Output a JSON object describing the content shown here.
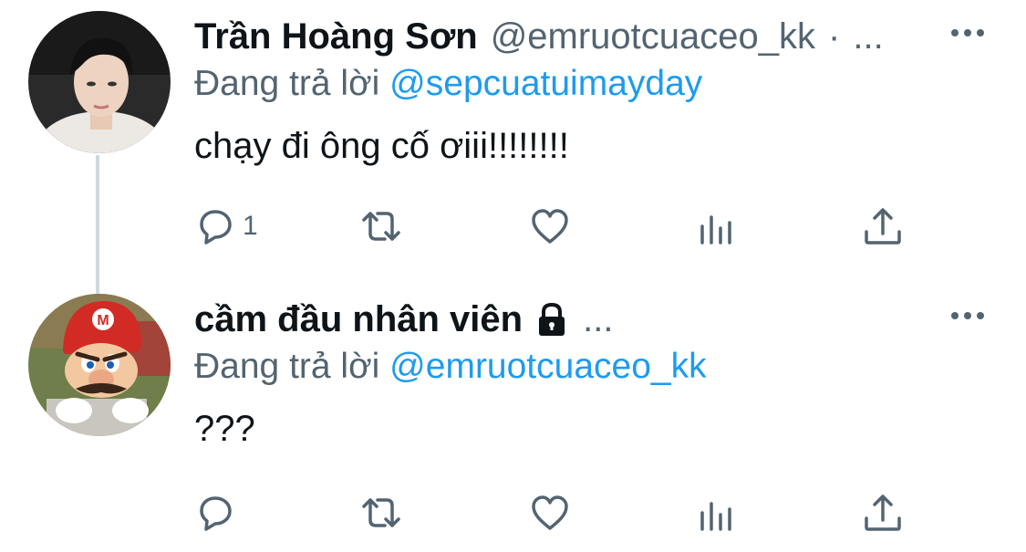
{
  "thread": [
    {
      "author": {
        "name": "Trần Hoàng Sơn",
        "handle": "@emruotcuaceo_kk",
        "separator": "·",
        "truncation": "..."
      },
      "reply_label": "Đang trả lời",
      "reply_to": "@sepcuatuimayday",
      "text": "chạy đi ông cố ơiii!!!!!!!!",
      "reply_count": "1",
      "avatar": "avatar-young-man-photo",
      "icons": {
        "more": "more-icon",
        "reply": "reply-icon",
        "retweet": "retweet-icon",
        "like": "like-icon",
        "views": "views-icon",
        "share": "share-icon"
      }
    },
    {
      "author": {
        "name": "cầm đầu nhân viên",
        "protected": true,
        "truncation": "..."
      },
      "reply_label": "Đang trả lời",
      "reply_to": "@emruotcuaceo_kk",
      "text": "???",
      "reply_count": "",
      "avatar": "avatar-mario-at-keyboard"
    }
  ],
  "colors": {
    "text": "#0f1419",
    "secondary": "#536471",
    "link": "#1d9bf0",
    "thread_line": "#cfd9de"
  }
}
